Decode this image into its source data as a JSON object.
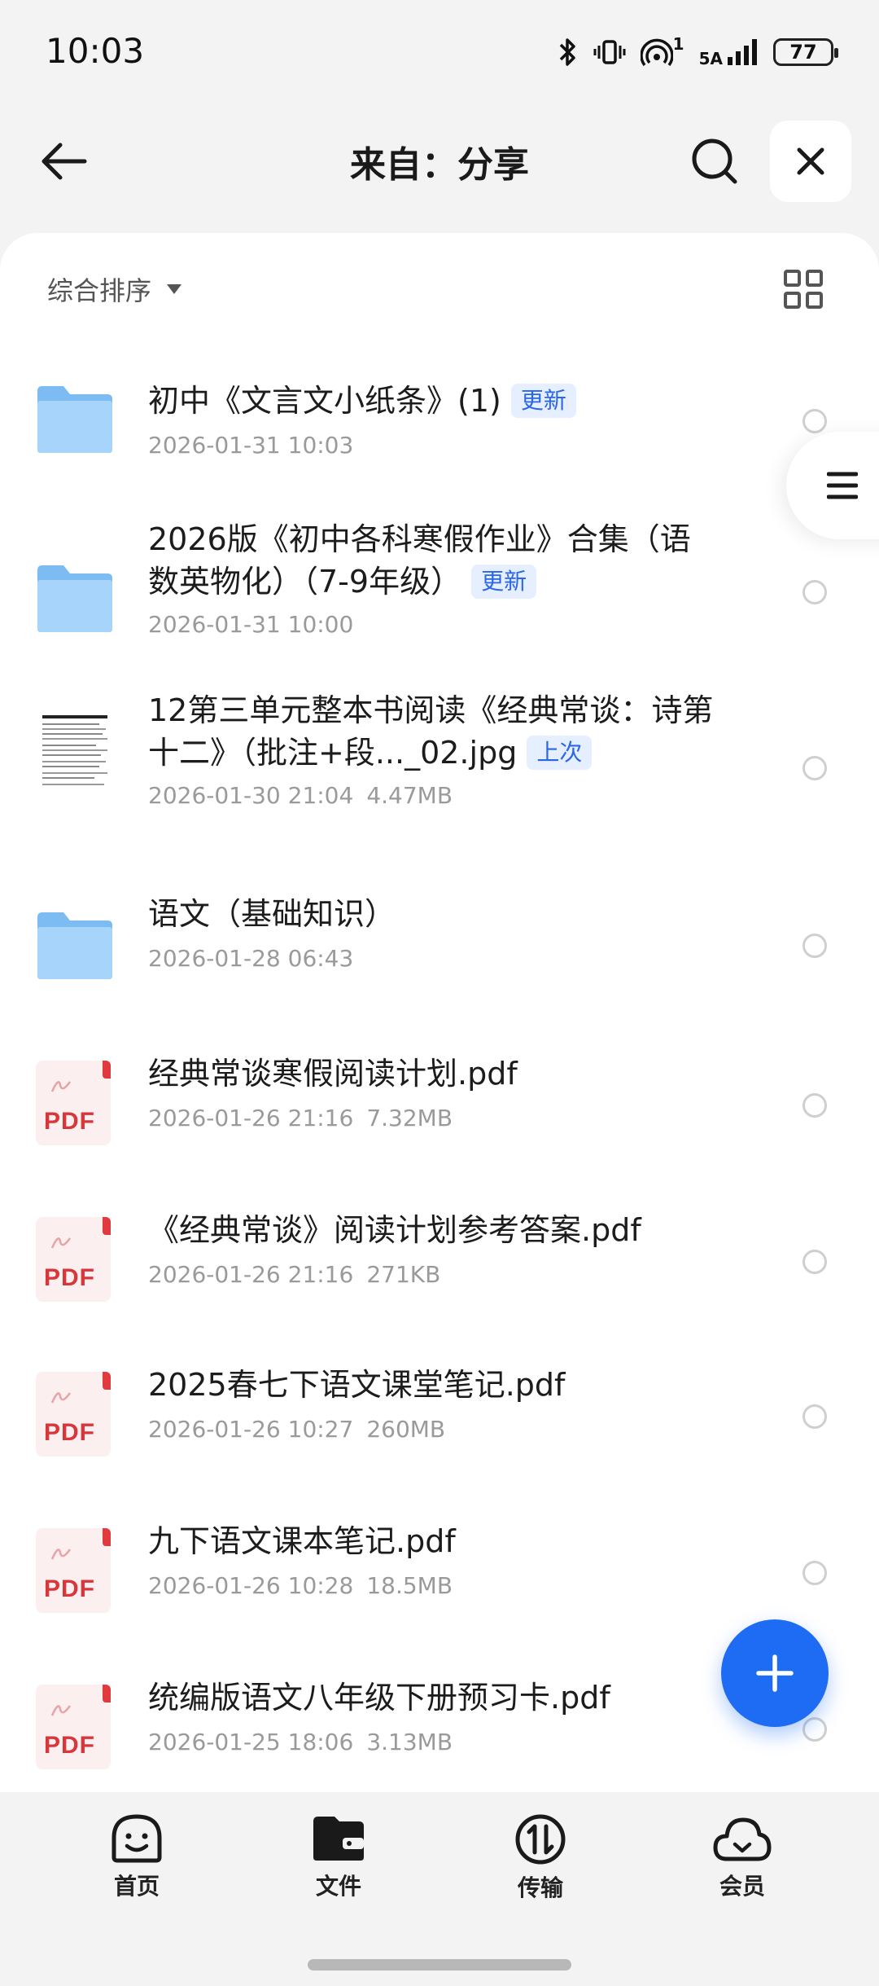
{
  "status_bar": {
    "time": "10:03",
    "battery": "77",
    "signal_label": "5A",
    "hotspot_count": "1",
    "icons": [
      "bluetooth-icon",
      "vibrate-icon",
      "hotspot-icon",
      "signal-icon",
      "battery-icon"
    ]
  },
  "header": {
    "title": "来自：分享",
    "icons": [
      "back-arrow-icon",
      "search-icon",
      "close-icon"
    ]
  },
  "toolbar": {
    "sort_label": "综合排序",
    "icons": [
      "dropdown-triangle-icon",
      "grid-view-icon"
    ]
  },
  "files": [
    {
      "type": "folder",
      "name": "初中《文言文小纸条》(1)",
      "tag": "更新",
      "date": "2026-01-31 10:03",
      "size": ""
    },
    {
      "type": "folder",
      "name": "2026版《初中各科寒假作业》合集（语数英物化）（7-9年级）",
      "tag": "更新",
      "date": "2026-01-31 10:00",
      "size": ""
    },
    {
      "type": "image",
      "name": "12第三单元整本书阅读《经典常谈：诗第十二》（批注+段..._02.jpg",
      "tag": "上次",
      "date": "2026-01-30 21:04",
      "size": "4.47MB"
    },
    {
      "type": "folder",
      "name": "语文（基础知识）",
      "tag": "",
      "date": "2026-01-28 06:43",
      "size": ""
    },
    {
      "type": "pdf",
      "name": "经典常谈寒假阅读计划.pdf",
      "tag": "",
      "date": "2026-01-26 21:16",
      "size": "7.32MB"
    },
    {
      "type": "pdf",
      "name": "《经典常谈》阅读计划参考答案.pdf",
      "tag": "",
      "date": "2026-01-26 21:16",
      "size": "271KB"
    },
    {
      "type": "pdf",
      "name": "2025春七下语文课堂笔记.pdf",
      "tag": "",
      "date": "2026-01-26 10:27",
      "size": "260MB"
    },
    {
      "type": "pdf",
      "name": "九下语文课本笔记.pdf",
      "tag": "",
      "date": "2026-01-26 10:28",
      "size": "18.5MB"
    },
    {
      "type": "pdf",
      "name": "统编版语文八年级下册预习卡.pdf",
      "tag": "",
      "date": "2026-01-25 18:06",
      "size": "3.13MB"
    }
  ],
  "file_type_labels": {
    "pdf": "PDF"
  },
  "fab": {
    "icon": "plus-icon"
  },
  "side_handle": {
    "icon": "menu-icon"
  },
  "nav": [
    {
      "label": "首页",
      "icon": "home-face-icon"
    },
    {
      "label": "文件",
      "icon": "folder-wallet-icon"
    },
    {
      "label": "传输",
      "icon": "transfer-icon"
    },
    {
      "label": "会员",
      "icon": "cloud-icon"
    }
  ],
  "colors": {
    "accent": "#1e6cf4",
    "tag_bg": "#e6efff",
    "tag_text": "#2a66e8",
    "folder": "#8cc6f7",
    "pdf_red": "#d9363b"
  }
}
